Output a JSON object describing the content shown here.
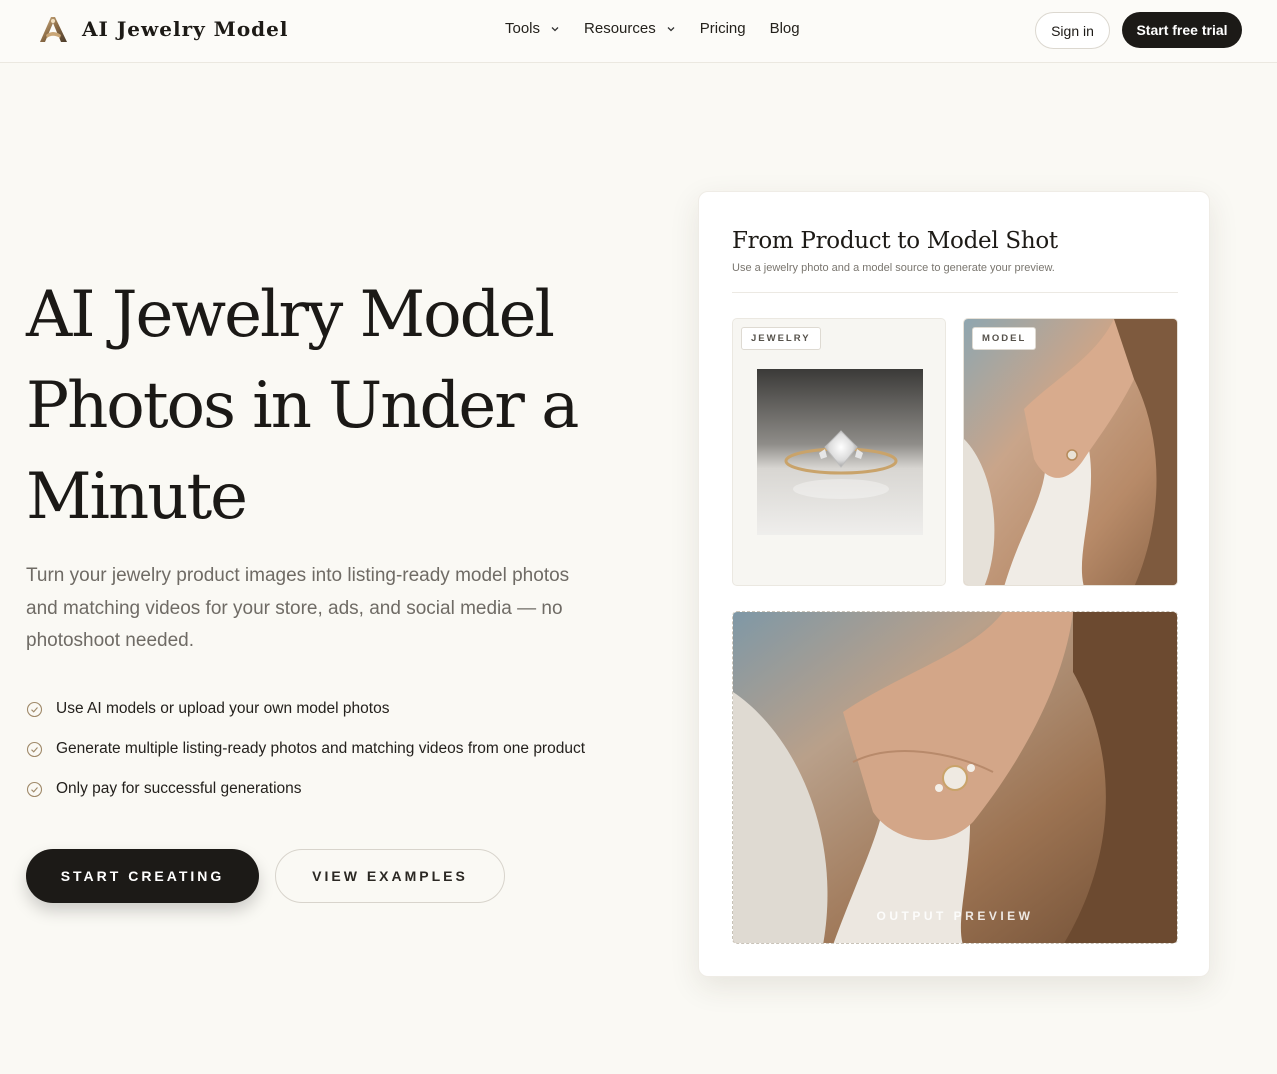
{
  "header": {
    "logo_text": "AI Jewelry Model",
    "nav": [
      {
        "label": "Tools",
        "has_dropdown": true
      },
      {
        "label": "Resources",
        "has_dropdown": true
      },
      {
        "label": "Pricing",
        "has_dropdown": false
      },
      {
        "label": "Blog",
        "has_dropdown": false
      }
    ],
    "signin_label": "Sign in",
    "trial_label": "Start free trial"
  },
  "hero": {
    "title_lines": [
      "AI Jewelry Model",
      "Photos in Under a",
      "Minute"
    ],
    "subtitle": "Turn your jewelry product images into listing-ready model photos and matching videos for your store, ads, and social media — no photoshoot needed.",
    "features": [
      "Use AI models or upload your own model photos",
      "Generate multiple listing-ready photos and matching videos from one product",
      "Only pay for successful generations"
    ],
    "primary_cta": "START CREATING",
    "secondary_cta": "VIEW EXAMPLES"
  },
  "card": {
    "title": "From Product to Model Shot",
    "subtitle": "Use a jewelry photo and a model source to generate your preview.",
    "jewelry_tag": "JEWELRY",
    "model_tag": "MODEL",
    "output_label": "OUTPUT PREVIEW"
  },
  "colors": {
    "background": "#faf9f4",
    "primary": "#1c1a17",
    "accent_check": "#a08a6a"
  }
}
